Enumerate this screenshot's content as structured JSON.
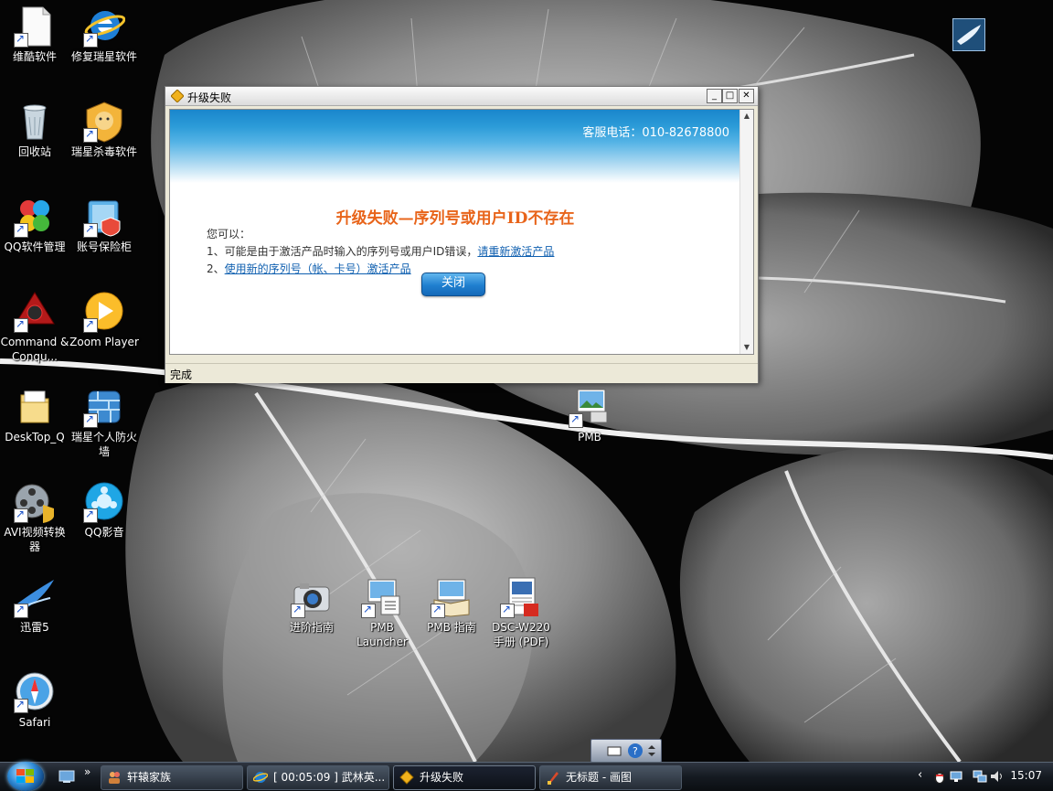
{
  "desktop": {
    "icons": [
      {
        "label": "维酷软件"
      },
      {
        "label": "修复瑞星软件"
      },
      {
        "label": "回收站"
      },
      {
        "label": "瑞星杀毒软件"
      },
      {
        "label": "QQ软件管理"
      },
      {
        "label": "账号保险柜"
      },
      {
        "label": "Command & Conqu..."
      },
      {
        "label": "Zoom Player"
      },
      {
        "label": "DeskTop_Q"
      },
      {
        "label": "瑞星个人防火墙"
      },
      {
        "label": "AVI视频转换器"
      },
      {
        "label": "QQ影音"
      },
      {
        "label": "迅雷5"
      },
      {
        "label": "Safari"
      },
      {
        "label": "PMB"
      },
      {
        "label": "进阶指南"
      },
      {
        "label": "PMB Launcher"
      },
      {
        "label": "PMB 指南"
      },
      {
        "label": "DSC-W220 手册 (PDF)"
      }
    ]
  },
  "dialog": {
    "title": "升级失败",
    "min_glyph": "_",
    "max_glyph": "□",
    "close_glyph": "✕",
    "phone": "客服电话：010-82678800",
    "headline": "升级失败—序列号或用户ID不存在",
    "intro": "您可以：",
    "item1_prefix": "1、可能是由于激活产品时输入的序列号或用户ID错误，",
    "item1_link": "请重新激活产品",
    "item2_prefix": "2、",
    "item2_link": "使用新的序列号（帐、卡号）激活产品",
    "close_button": "关闭",
    "status": "完成"
  },
  "taskbar": {
    "chevron": "»",
    "tasks": [
      {
        "label": "轩辕家族"
      },
      {
        "label": "[ 00:05:09 ] 武林英..."
      },
      {
        "label": "升级失败"
      },
      {
        "label": "无标题 - 画图"
      }
    ],
    "tray_chevron": "‹",
    "clock": "15:07"
  },
  "colors": {
    "headline": "#e8641a",
    "link": "#1060b0",
    "banner": "#1a86cc"
  }
}
